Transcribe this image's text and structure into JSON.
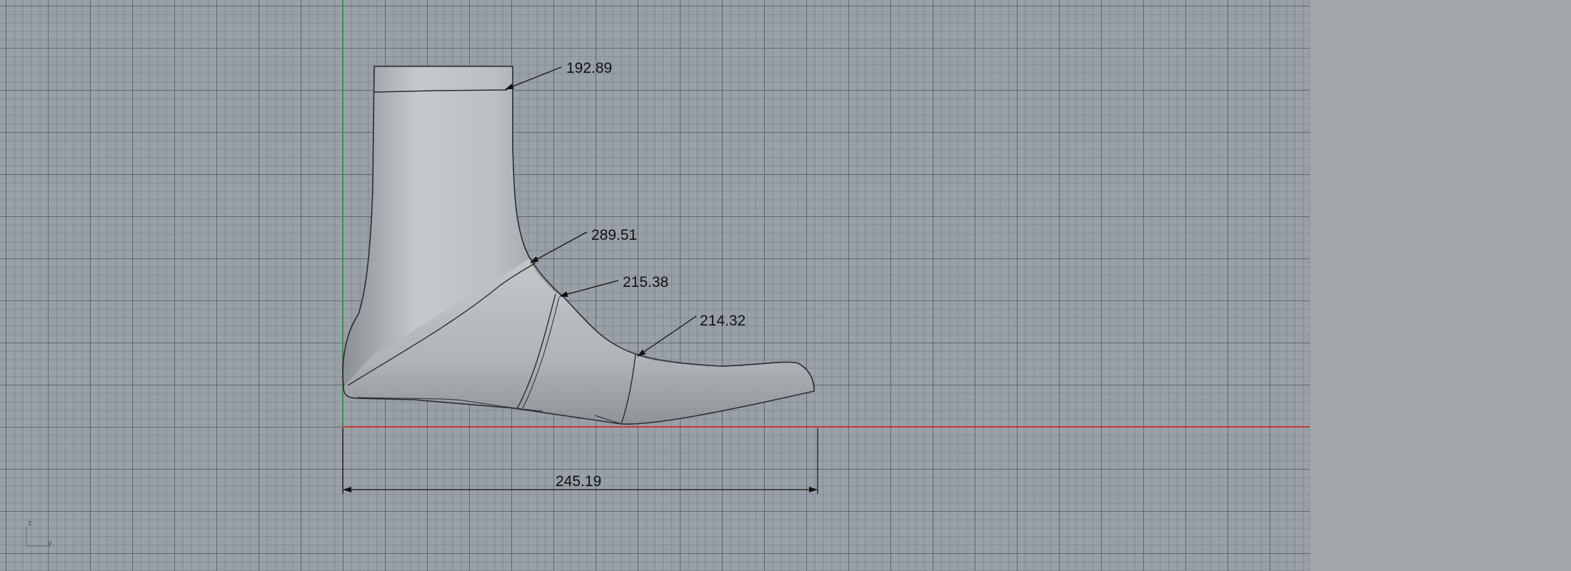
{
  "viewport": {
    "dimensions": {
      "ankle_top": "192.89",
      "instep": "289.51",
      "waist": "215.38",
      "ball": "214.32",
      "length": "245.19"
    },
    "axis_widget": {
      "vertical": "z",
      "horizontal": "y"
    }
  },
  "colors": {
    "x_axis": "#c23a3a",
    "z_axis": "#2e9a3e",
    "grid_background": "#9aa0a8",
    "side_panel": "#a3a6ab"
  }
}
